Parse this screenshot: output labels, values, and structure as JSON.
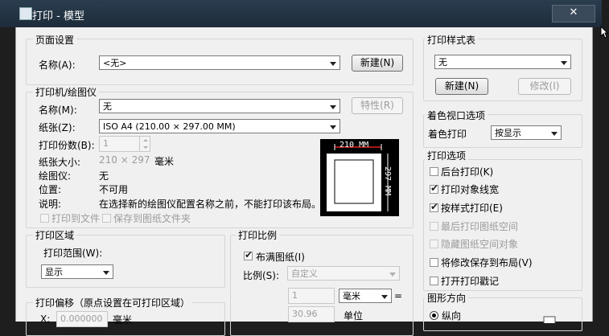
{
  "window": {
    "title": "打印 - 模型",
    "close_glyph": "✕"
  },
  "page_setup": {
    "group_label": "页面设置",
    "name_label": "名称(A):",
    "name_value": "<无>",
    "add_button": "新建(N)"
  },
  "printer": {
    "group_label": "打印机/绘图仪",
    "name_label": "名称(M):",
    "name_value": "无",
    "properties_button": "特性(R)",
    "paper_label": "纸张(Z):",
    "paper_value": "ISO A4 (210.00 × 297.00 MM)",
    "copies_label": "打印份数(B):",
    "copies_value": "1",
    "paper_size_label": "纸张大小:",
    "paper_size_value": "210 × 297",
    "paper_size_unit": "毫米",
    "plotter_label": "绘图仪:",
    "plotter_value": "无",
    "location_label": "位置:",
    "location_value": "不可用",
    "desc_label": "说明:",
    "desc_value": "在选择新的绘图仪配置名称之前，不能打印该布局。",
    "print_to_file": "打印到文件",
    "save_changes": "保存到图纸文件夹",
    "preview_width": "210 MM",
    "preview_height": "297 MM"
  },
  "plot_area": {
    "group_label": "打印区域",
    "range_label": "打印范围(W):",
    "range_value": "显示"
  },
  "plot_offset": {
    "group_label": "打印偏移（原点设置在可打印区域）",
    "x_label": "X:",
    "x_value": "0.000000",
    "unit": "毫米"
  },
  "plot_scale": {
    "group_label": "打印比例",
    "fit_label": "布满图纸(I)",
    "scale_label": "比例(S):",
    "scale_value": "自定义",
    "num_value": "1",
    "unit_value": "毫米",
    "equals": "=",
    "den_value": "30.96",
    "den_unit": "单位"
  },
  "plot_style": {
    "group_label": "打印样式表",
    "value": "无",
    "new_button": "新建(N)",
    "edit_button": "修改(I)"
  },
  "shaded": {
    "group_label": "着色视口选项",
    "shade_label": "着色打印",
    "shade_value": "按显示"
  },
  "plot_options": {
    "group_label": "打印选项",
    "items": [
      {
        "label": "后台打印(K)",
        "checked": false,
        "enabled": true
      },
      {
        "label": "打印对象线宽",
        "checked": true,
        "enabled": true
      },
      {
        "label": "按样式打印(E)",
        "checked": true,
        "enabled": true
      },
      {
        "label": "最后打印图纸空间",
        "checked": false,
        "enabled": false
      },
      {
        "label": "隐藏图纸空间对象",
        "checked": false,
        "enabled": false
      },
      {
        "label": "将修改保存到布局(V)",
        "checked": false,
        "enabled": true
      },
      {
        "label": "打开打印戳记",
        "checked": false,
        "enabled": true
      }
    ]
  },
  "orientation": {
    "group_label": "图形方向",
    "portrait_label": "纵向"
  }
}
